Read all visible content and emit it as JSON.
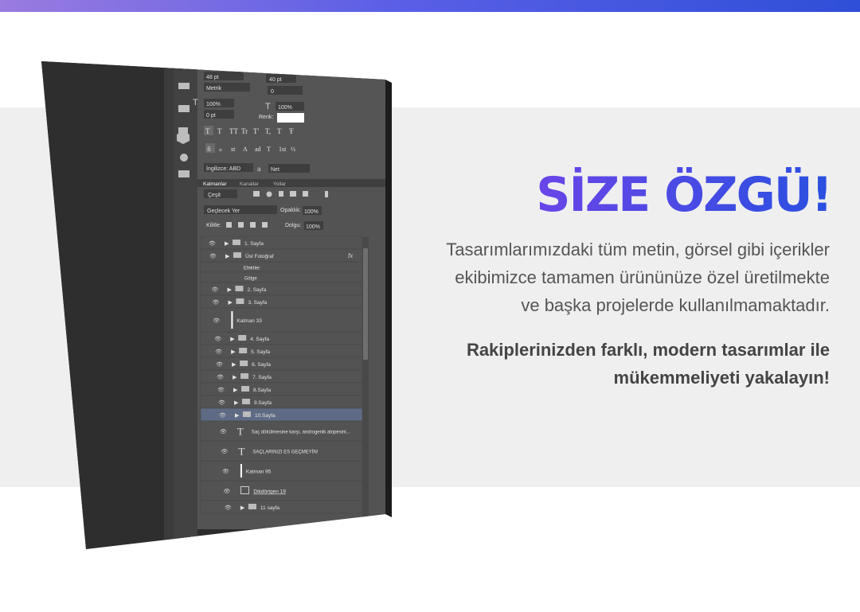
{
  "headline": "SİZE ÖZGÜ!",
  "paragraph": {
    "line1": "Tasarımlarımızdaki tüm metin, görsel gibi içerikler",
    "line2": "ekibimizce tamamen ürününüze özel üretilmekte",
    "line3": "ve başka projelerde kullanılmamaktadır."
  },
  "highlight": {
    "line1": "Rakiplerinizden farklı, modern tasarımlar ile",
    "line2": "mükemmeliyeti yakalayın!"
  },
  "colors": {
    "gradient_start": "#9a7be0",
    "gradient_end": "#2f4fd8",
    "headline": "#3d46e0",
    "band": "#efeff0"
  },
  "ps": {
    "char": {
      "font_size": "48 pt",
      "leading": "40 pt",
      "kerning": "Metrik",
      "tracking": "0",
      "vscale": "100%",
      "hscale": "100%",
      "baseline": "0 pt",
      "color_label": "Renk:",
      "language": "İngilizce: ABD",
      "aa_label": "a",
      "aa_value": "Net",
      "style_buttons": [
        "T",
        "T",
        "TT",
        "Tr",
        "T'",
        "T,",
        "T",
        "Ŧ"
      ],
      "otype_buttons": [
        "fi",
        "ℴ",
        "st",
        "A",
        "ad",
        "T",
        "1st",
        "½"
      ]
    },
    "tabs": [
      "Katmanlar",
      "Kanallar",
      "Yollar"
    ],
    "filter_label": "Çeşit",
    "blend_mode": "Geçlecek Yer",
    "opacity_label": "Opaklık:",
    "opacity_value": "100%",
    "lock_label": "Kilitle:",
    "fill_label": "Dolgu:",
    "fill_value": "100%",
    "fx_label": "fx",
    "layers": [
      {
        "name": "1. Sayfa",
        "kind": "folder"
      },
      {
        "name": "Üst Fotoğraf",
        "kind": "folder"
      },
      {
        "name": "Efektler",
        "kind": "effect"
      },
      {
        "name": "Gölge",
        "kind": "effect"
      },
      {
        "name": "2. Sayfa",
        "kind": "folder"
      },
      {
        "name": "3. Sayfa",
        "kind": "folder"
      },
      {
        "name": "Katman 33",
        "kind": "layer"
      },
      {
        "name": "4. Sayfa",
        "kind": "folder"
      },
      {
        "name": "5. Sayfa",
        "kind": "folder"
      },
      {
        "name": "6. Sayfa",
        "kind": "folder"
      },
      {
        "name": "7. Sayfa",
        "kind": "folder"
      },
      {
        "name": "8.Sayfa",
        "kind": "folder"
      },
      {
        "name": "9.Sayfa",
        "kind": "folder"
      },
      {
        "name": "10.Sayfa",
        "kind": "folder",
        "selected": true
      },
      {
        "name": "Saç dökülmesine karşı, androgenik alopesini...",
        "kind": "text"
      },
      {
        "name": "SAÇLARINIZI ES GEÇMEYİN!",
        "kind": "text"
      },
      {
        "name": "Katman 95",
        "kind": "layer"
      },
      {
        "name": "Dikdörtgen 19",
        "kind": "shape"
      },
      {
        "name": "11 sayfa",
        "kind": "folder"
      }
    ]
  }
}
